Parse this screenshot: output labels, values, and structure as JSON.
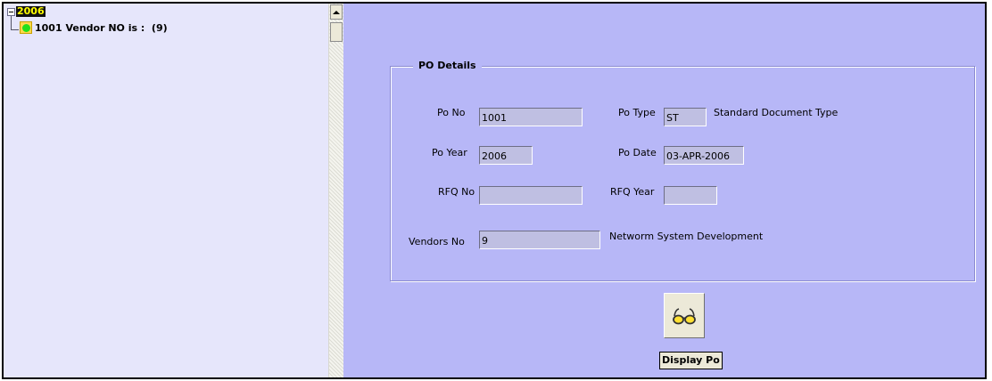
{
  "tree": {
    "root_label": "2006",
    "child_label": "1001 Vendor NO is :  (9)"
  },
  "po_details": {
    "group_title": "PO Details",
    "po_no_label": "Po No",
    "po_no_value": "1001",
    "po_type_label": "Po Type",
    "po_type_value": "ST",
    "po_type_description": "Standard Document Type",
    "po_year_label": "Po Year",
    "po_year_value": "2006",
    "po_date_label": "Po Date",
    "po_date_value": "03-APR-2006",
    "rfq_no_label": "RFQ No",
    "rfq_no_value": "",
    "rfq_year_label": "RFQ  Year",
    "rfq_year_value": "",
    "vendors_no_label": "Vendors No",
    "vendors_no_value": "9",
    "vendor_name": "Networm System Development"
  },
  "actions": {
    "display_po_label": "Display Po",
    "display_po_icon": "glasses-icon"
  },
  "colors": {
    "tree_background": "#e6e6fb",
    "details_background": "#b7b7f7",
    "field_background": "#bfbfe2",
    "root_highlight": "#101010",
    "root_text": "#ffff00",
    "node_icon": "#ffd84a",
    "node_dot": "#22e01a"
  }
}
